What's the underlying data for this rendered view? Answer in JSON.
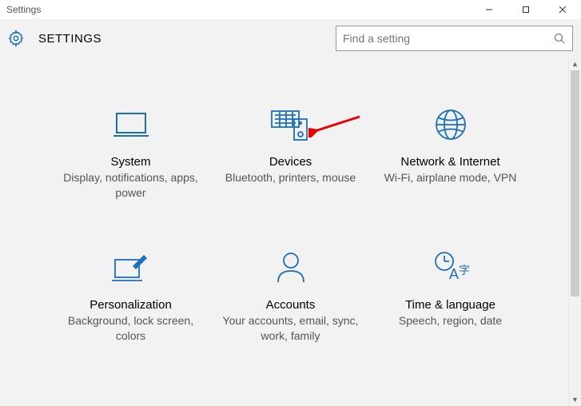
{
  "window_title": "Settings",
  "header_title": "SETTINGS",
  "search": {
    "placeholder": "Find a setting"
  },
  "tiles": [
    {
      "title": "System",
      "desc": "Display, notifications, apps, power"
    },
    {
      "title": "Devices",
      "desc": "Bluetooth, printers, mouse"
    },
    {
      "title": "Network & Internet",
      "desc": "Wi-Fi, airplane mode, VPN"
    },
    {
      "title": "Personalization",
      "desc": "Background, lock screen, colors"
    },
    {
      "title": "Accounts",
      "desc": "Your accounts, email, sync, work, family"
    },
    {
      "title": "Time & language",
      "desc": "Speech, region, date"
    }
  ],
  "colors": {
    "accent": "#1d6fbd"
  }
}
